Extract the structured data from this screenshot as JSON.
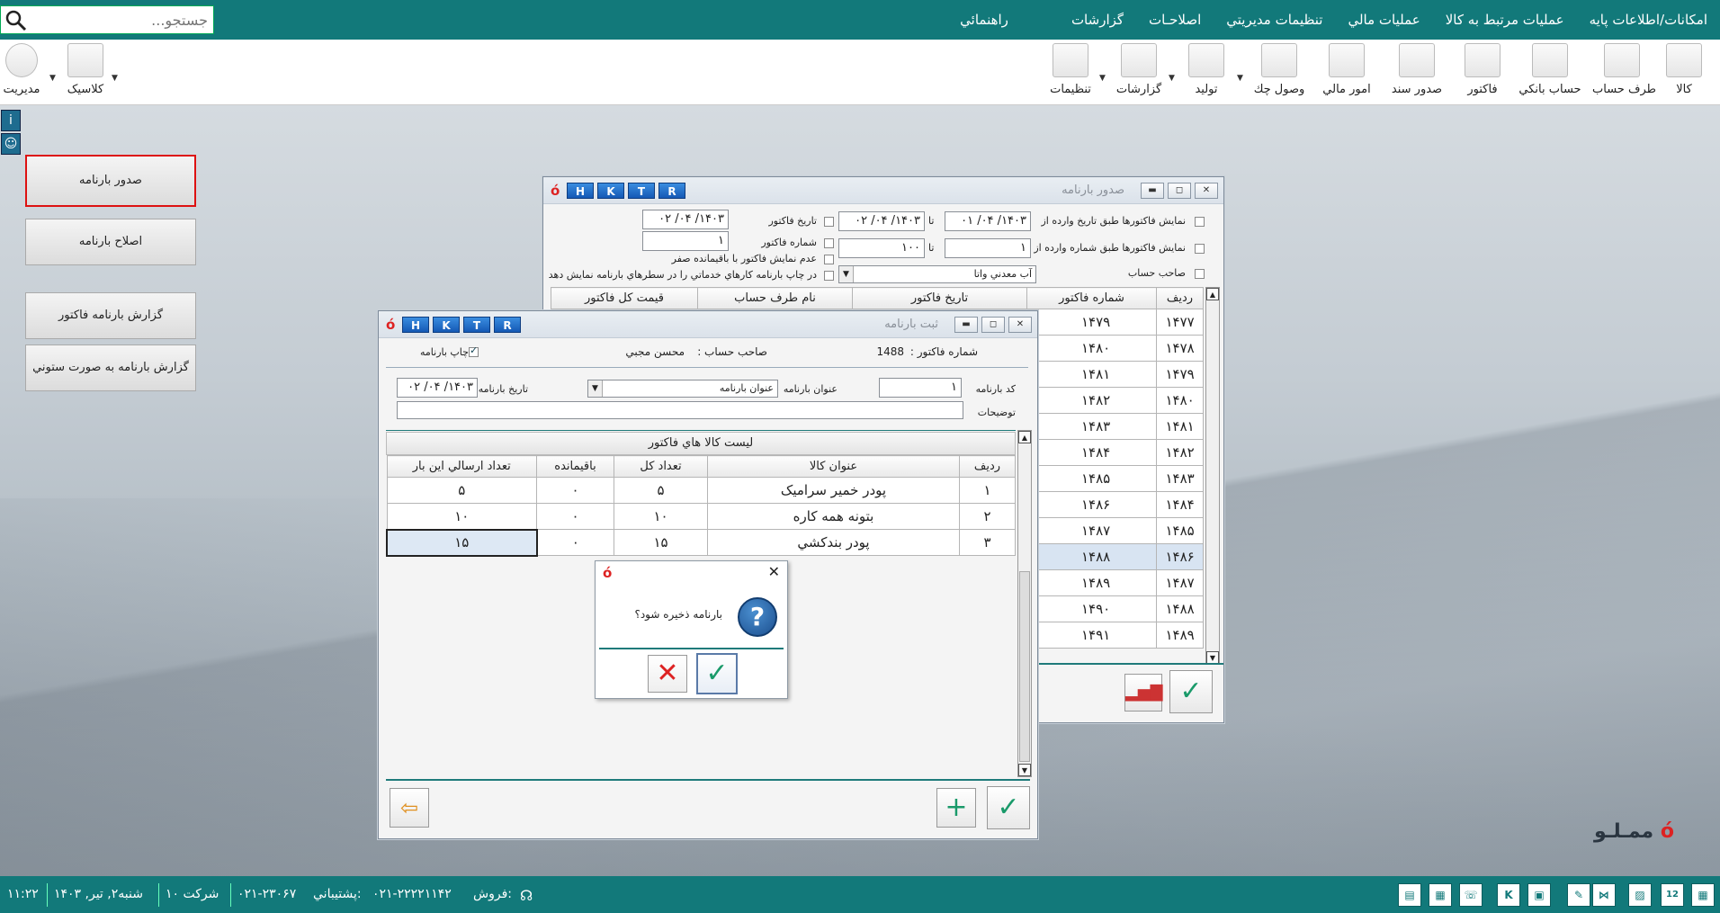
{
  "search": {
    "placeholder": "جستجو..."
  },
  "menu": [
    "امکانات/اطلاعات پایه",
    "عملیات مرتبط به کالا",
    "عملیات مالي",
    "تنظيمات مديريتي",
    "اصلاحـات",
    "گزارشات",
    "راهنمائي"
  ],
  "toolbar": {
    "items": [
      "کالا",
      "طرف حساب",
      "حساب بانکي",
      "فاکتور",
      "صدور سند",
      "امور مالي",
      "وصول چك",
      "تولید",
      "گزارشات",
      "تنظیمات"
    ],
    "left_items": [
      "مدیریت",
      "کلاسیک"
    ]
  },
  "left_buttons": [
    "صدور بارنامه",
    "اصلاح بارنامه",
    "گزارش بارنامه فاکتور",
    "گزارش بارنامه به صورت ستوني"
  ],
  "hk": [
    "H",
    "K",
    "T",
    "R"
  ],
  "win1": {
    "title": "صدور بارنامه",
    "lbl_from_date": "نمایش فاکتورها طبق تاریخ وارده از",
    "lbl_from_num": "نمایش فاکتورها طبق شماره وارده از",
    "lbl_owner": "صاحب حساب",
    "lbl_to": "تا",
    "date_from": "۱۴۰۳/ ۰۴/ ۰۱",
    "date_to": "۱۴۰۳/ ۰۴/ ۰۲",
    "num_from": "۱",
    "num_to": "۱۰۰",
    "owner": "آب معدني واتا",
    "lbl_inv_date": "تاریخ فاکتور",
    "inv_date": "۱۴۰۳/ ۰۴/ ۰۲",
    "lbl_inv_num": "شماره فاکتور",
    "inv_num": "۱",
    "lbl_no_zero": "عدم نمایش فاکتور با باقیمانده صفر",
    "lbl_print_service": "در چاپ بارنامه کارهاي خدماتي را در سطرهاي بارنامه نمایش دهد",
    "columns": [
      "ردیف",
      "شماره فاکتور",
      "تاریخ فاکتور",
      "نام طرف حساب",
      "قیمت کل فاکتور"
    ],
    "rows": [
      [
        "۱۴۷۷",
        "۱۴۷۹"
      ],
      [
        "۱۴۷۸",
        "۱۴۸۰"
      ],
      [
        "۱۴۷۹",
        "۱۴۸۱"
      ],
      [
        "۱۴۸۰",
        "۱۴۸۲"
      ],
      [
        "۱۴۸۱",
        "۱۴۸۳"
      ],
      [
        "۱۴۸۲",
        "۱۴۸۴"
      ],
      [
        "۱۴۸۳",
        "۱۴۸۵"
      ],
      [
        "۱۴۸۴",
        "۱۴۸۶"
      ],
      [
        "۱۴۸۵",
        "۱۴۸۷"
      ],
      [
        "۱۴۸۶",
        "۱۴۸۸"
      ],
      [
        "۱۴۸۷",
        "۱۴۸۹"
      ],
      [
        "۱۴۸۸",
        "۱۴۹۰"
      ],
      [
        "۱۴۸۹",
        "۱۴۹۱"
      ]
    ]
  },
  "win2": {
    "title": "ثبت بارنامه",
    "invoice_no_label": "شماره فاکتور :",
    "invoice_no": "1488",
    "owner_label": "صاحب حساب :",
    "owner": "محسن مجبي",
    "print_label": "چاپ بارنامه",
    "code_label": "کد بارنامه",
    "code": "۱",
    "title_label": "عنوان بارنامه",
    "title_value": "عنوان بارنامه",
    "date_label": "تاریخ بارنامه",
    "date": "۱۴۰۳/ ۰۴/ ۰۲",
    "desc_label": "توضیحات",
    "list_title": "لیست کالا هاي فاکتور",
    "columns": [
      "ردیف",
      "عنوان کالا",
      "تعداد کل",
      "باقیمانده",
      "تعداد ارسالي این بار"
    ],
    "rows": [
      [
        "۱",
        "پودر خمیر سرامیک",
        "۵",
        "۰",
        "۵"
      ],
      [
        "۲",
        "بتونه همه کاره",
        "۱۰",
        "۰",
        "۱۰"
      ],
      [
        "۳",
        "پودر بندکشي",
        "۱۵",
        "۰",
        "۱۵"
      ]
    ]
  },
  "dialog": {
    "message": "بارنامه ذخیره شود؟"
  },
  "brand": {
    "name": "ممـلـو"
  },
  "status": {
    "sales_label": "فروش:",
    "sales": "۰۲۱-۲۲۲۲۱۱۴۲",
    "support_label": "پشتیباني:",
    "support": "۰۲۱-۲۳۰۶۷",
    "company": "شرکت ۱۰",
    "date": "شنبه۲, تیر, ۱۴۰۳",
    "time": "۱۱:۲۲"
  }
}
